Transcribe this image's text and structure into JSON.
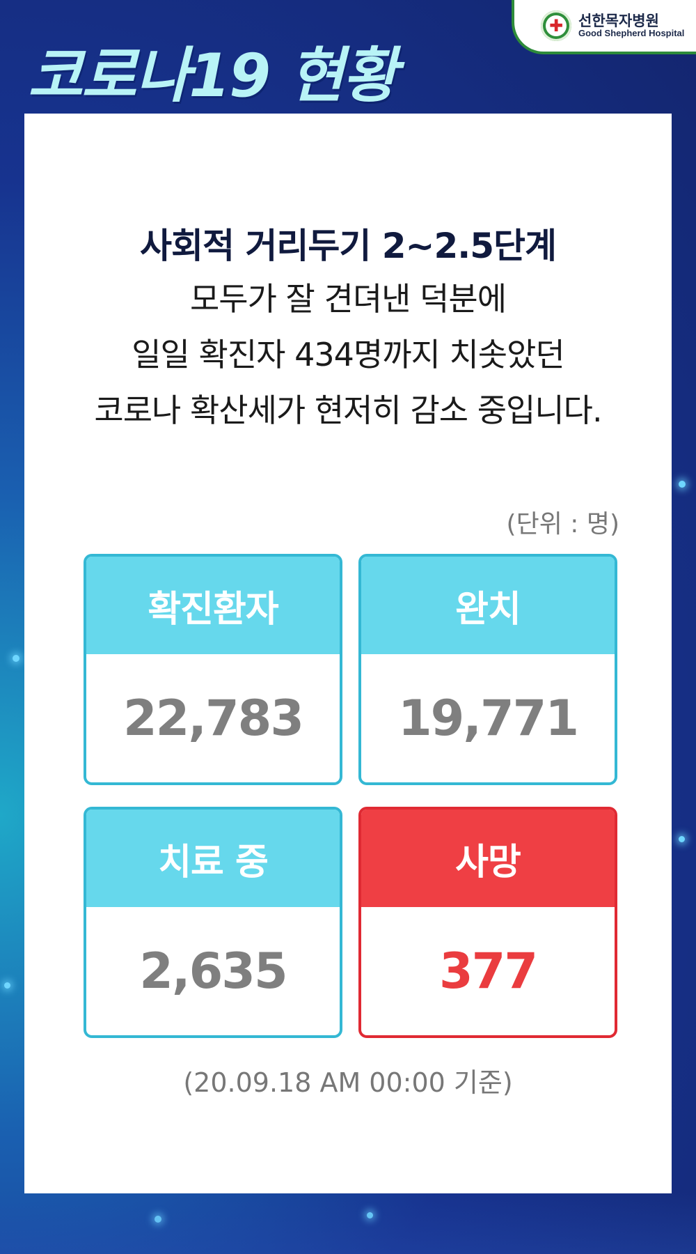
{
  "brand": {
    "name_kr": "선한목자병원",
    "name_en": "Good Shepherd Hospital",
    "colors": {
      "primary_green": "#2e8b3a",
      "cross_red": "#d8262b"
    },
    "icon": "hospital-cross-emblem"
  },
  "title": "코로나19 현황",
  "message": {
    "headline": "사회적 거리두기 2~2.5단계",
    "lines": [
      "모두가 잘 견뎌낸 덕분에",
      "일일 확진자 434명까지 치솟았던",
      "코로나 확산세가 현저히 감소 중입니다."
    ]
  },
  "unit_note": "(단위 : 명)",
  "stats": [
    {
      "label": "확진환자",
      "value": "22,783",
      "color": "#66d8ec"
    },
    {
      "label": "완치",
      "value": "19,771",
      "color": "#66d8ec"
    },
    {
      "label": "치료 중",
      "value": "2,635",
      "color": "#66d8ec"
    },
    {
      "label": "사망",
      "value": "377",
      "color": "#ef3f44"
    }
  ],
  "date_note": "(20.09.18 AM 00:00 기준)",
  "colors": {
    "background": "#17338f",
    "title": "#b8f3f6",
    "accent_cyan": "#66d8ec",
    "accent_red": "#ef3f44"
  }
}
